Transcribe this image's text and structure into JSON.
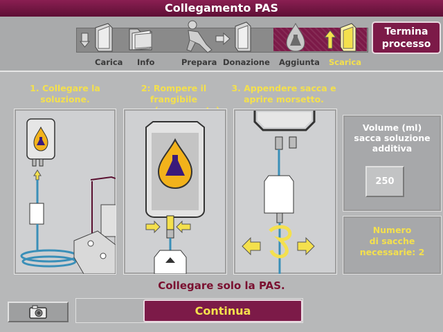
{
  "title": "Collegamento PAS",
  "steps": [
    {
      "label": "Carica",
      "active": false
    },
    {
      "label": "Info",
      "active": false
    },
    {
      "label": "Prepara",
      "active": false
    },
    {
      "label": "Donazione",
      "active": false
    },
    {
      "label": "Aggiunta",
      "active": false
    },
    {
      "label": "Scarica",
      "active": true
    }
  ],
  "end_button": {
    "line1": "Termina",
    "line2": "processo"
  },
  "instructions": {
    "step1": {
      "line1": "1. Collegare la",
      "line2": "soluzione."
    },
    "step2": {
      "line1": "2: Rompere il frangibile",
      "line2": "sacca (se presente)."
    },
    "step3": {
      "line1": "3. Appendere sacca e",
      "line2": "aprire morsetto."
    }
  },
  "volume": {
    "line1": "Volume (ml)",
    "line2": "sacca soluzione",
    "line3": "additiva",
    "value": "250"
  },
  "bags_needed": {
    "line1": "Numero",
    "line2": "di sacche",
    "line3": "necessarie: 2"
  },
  "message": "Collegare solo la PAS.",
  "continue_label": "Continua",
  "colors": {
    "accent": "#7c1a48",
    "highlight": "#f4e04d",
    "message": "#7a1030"
  }
}
